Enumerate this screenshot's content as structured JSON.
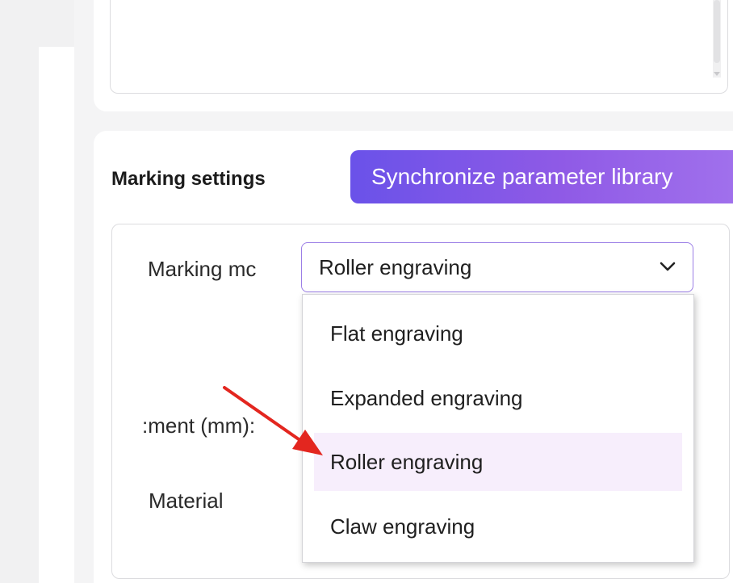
{
  "marking": {
    "section_title": "Marking settings",
    "sync_button_label": "Synchronize parameter library",
    "fields": {
      "mode_label": "Marking mc",
      "adjustment_label": ":ment (mm):",
      "material_label": "Material"
    },
    "mode_select": {
      "selected_value": "Roller engraving",
      "options": [
        {
          "label": "Flat engraving"
        },
        {
          "label": "Expanded engraving"
        },
        {
          "label": "Roller engraving"
        },
        {
          "label": "Claw engraving"
        }
      ]
    }
  },
  "colors": {
    "accent_gradient_start": "#6a52e9",
    "accent_gradient_end": "#a070ec",
    "selected_option_bg": "#f7eefc",
    "annotation_arrow": "#e3261f"
  },
  "icons": {
    "select_toggle": "chevron-down-icon",
    "annotation": "red-arrow-icon"
  }
}
